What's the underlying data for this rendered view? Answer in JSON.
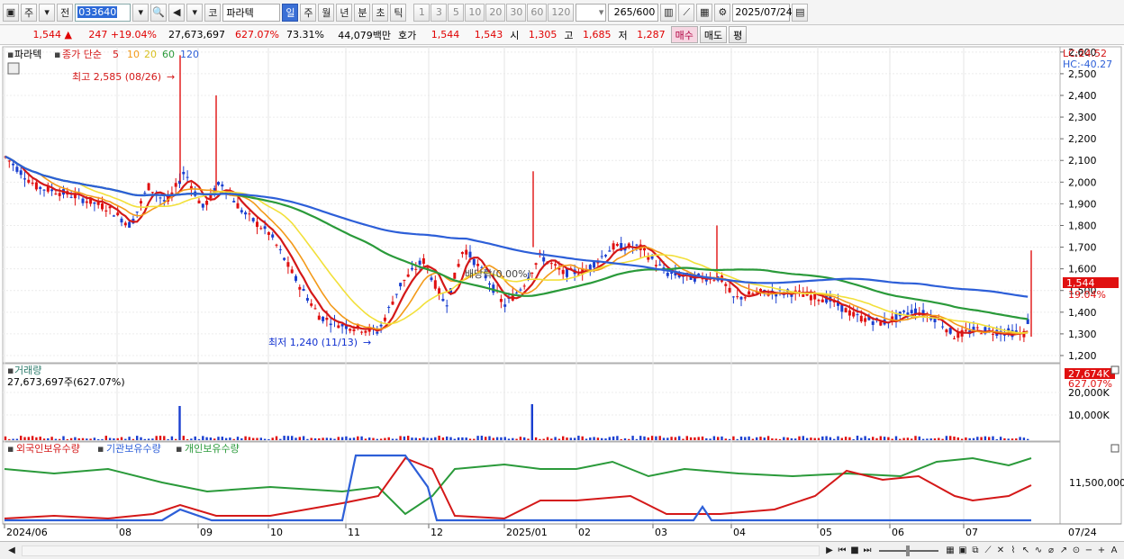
{
  "toolbar": {
    "period_label": "주",
    "prev_label": "전",
    "code": "033640",
    "market_label": "코",
    "name": "파라텍",
    "tabs": [
      "일",
      "주",
      "월",
      "년",
      "분",
      "초",
      "틱"
    ],
    "active_tab": "일",
    "intervals": [
      "1",
      "3",
      "5",
      "10",
      "20",
      "30",
      "60",
      "120"
    ],
    "count": "265",
    "count_total": "/600",
    "date": "2025/07/24"
  },
  "quote": {
    "price": "1,544",
    "change": "247",
    "change_pct": "+19.04%",
    "volume": "27,673,697",
    "volume_pct": "627.07%",
    "turnover_pct": "73.31%",
    "amount": "44,079백만",
    "bid_label": "호가",
    "bid1": "1,544",
    "bid2": "1,543",
    "open_label": "시",
    "open": "1,305",
    "high_label": "고",
    "high": "1,685",
    "low_label": "저",
    "low": "1,287",
    "buy_label": "매수",
    "sell_label": "매도",
    "eval_label": "평"
  },
  "price_panel": {
    "name": "파라텍",
    "legend_prefix": "종가 단순",
    "ma_labels": [
      "5",
      "10",
      "20",
      "60",
      "120"
    ],
    "ma_colors": [
      "#d41818",
      "#f39a1a",
      "#f2e03a",
      "#2a9a3a",
      "#2d5fd8"
    ],
    "lc_label": "LC:24.52",
    "hc_label": "HC:-40.27",
    "high_annot": "최고 2,585 (08/26)",
    "low_annot": "최저 1,240 (11/13)",
    "mid_annot": "배당락(0.00%)",
    "price_tag": "1,544",
    "pct_tag": "19.04%",
    "y_ticks": [
      "2,600",
      "2,500",
      "2,400",
      "2,300",
      "2,200",
      "2,100",
      "2,000",
      "1,900",
      "1,800",
      "1,700",
      "1,600",
      "1,500",
      "1,400",
      "1,300",
      "1,200"
    ]
  },
  "volume_panel": {
    "title": "거래량",
    "value": "27,673,697주(627.07%)",
    "tag": "27,674K",
    "tag_pct": "627.07%",
    "y_ticks": [
      "20,000K",
      "10,000K"
    ]
  },
  "holdings_panel": {
    "legend": [
      "외국인보유수량",
      "기관보유수량",
      "개인보유수량"
    ],
    "colors": [
      "#d41818",
      "#2d5fd8",
      "#2a9a3a"
    ],
    "y_tick": "11,500,000"
  },
  "x_axis": {
    "labels": [
      "2024/06",
      "08",
      "09",
      "10",
      "11",
      "12",
      "2025/01",
      "02",
      "03",
      "04",
      "05",
      "06",
      "07"
    ],
    "right_label": "07/24"
  },
  "bottom": {
    "icons": [
      "play-icon",
      "rewind-icon",
      "stop-icon",
      "forward-icon",
      "zoom-slider",
      "grid-icon",
      "trend-icon",
      "arrow-icon",
      "zoom-out-icon",
      "zoom-in-icon",
      "auto-icon"
    ]
  }
}
